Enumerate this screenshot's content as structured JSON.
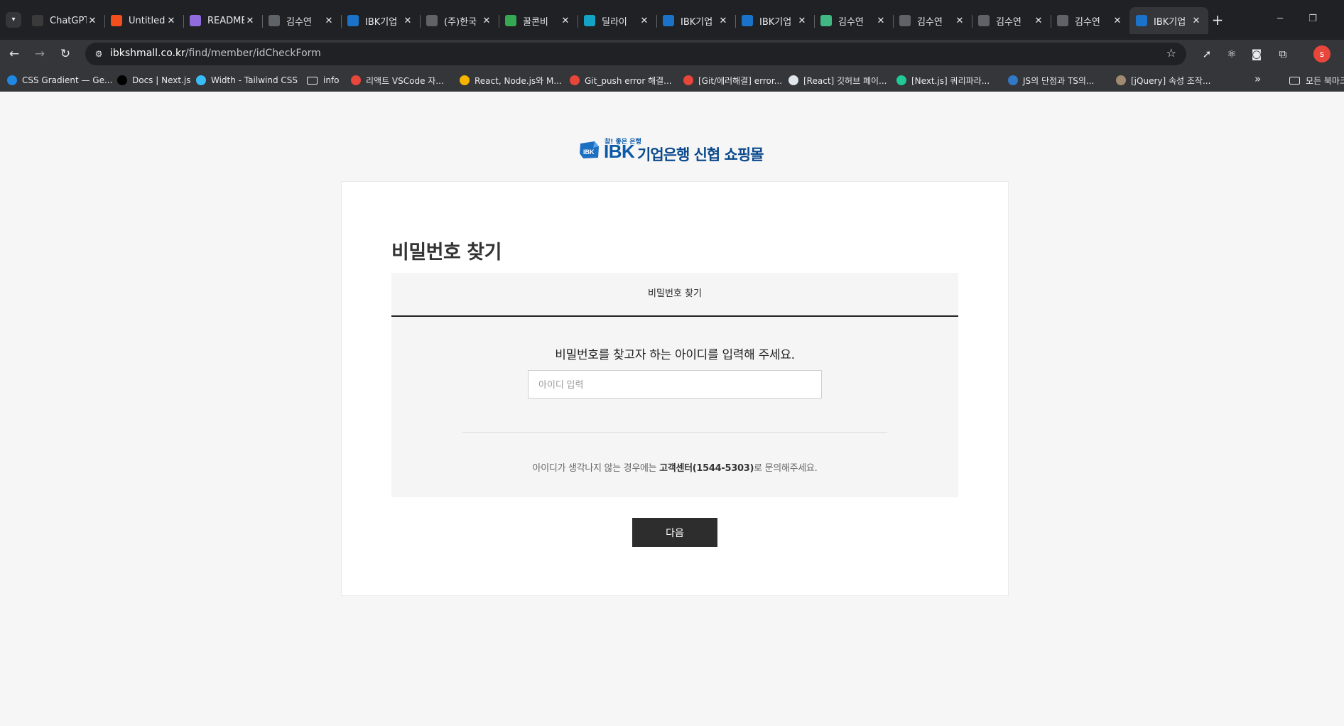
{
  "browser": {
    "tabs": [
      {
        "title": "ChatGPT",
        "icon": "chatgpt-icon",
        "color": "#3a3a3a"
      },
      {
        "title": "Untitled",
        "icon": "figma-icon",
        "color": "#f24e1e"
      },
      {
        "title": "README",
        "icon": "readme-icon",
        "color": "#8f6bdc"
      },
      {
        "title": "김수연",
        "icon": "globe-icon",
        "color": "#5f6368"
      },
      {
        "title": "IBK기업",
        "icon": "ibk-icon",
        "color": "#1a73c9"
      },
      {
        "title": "(주)한국",
        "icon": "globe-icon",
        "color": "#5f6368"
      },
      {
        "title": "꿀콘비",
        "icon": "play-icon",
        "color": "#34a853"
      },
      {
        "title": "딜라이",
        "icon": "d-icon",
        "color": "#13a3c4"
      },
      {
        "title": "IBK기업",
        "icon": "ibk-icon",
        "color": "#1a73c9"
      },
      {
        "title": "IBK기업",
        "icon": "ibk-icon",
        "color": "#1a73c9"
      },
      {
        "title": "김수연",
        "icon": "vue-icon",
        "color": "#41b883"
      },
      {
        "title": "김수연",
        "icon": "globe-icon",
        "color": "#5f6368"
      },
      {
        "title": "김수연",
        "icon": "globe-icon",
        "color": "#5f6368"
      },
      {
        "title": "김수연",
        "icon": "globe-icon",
        "color": "#5f6368"
      },
      {
        "title": "IBK기업",
        "icon": "ibk-icon",
        "color": "#1a73c9",
        "active": true
      }
    ],
    "url_host": "ibkshmall.co.kr",
    "url_path": "/find/member/idCheckForm",
    "profile_initial": "s",
    "bookmarks": [
      {
        "label": "CSS Gradient — Ge...",
        "icon": "css-gradient-icon",
        "color": "#1e88e5"
      },
      {
        "label": "Docs | Next.js",
        "icon": "nextjs-icon",
        "color": "#000000"
      },
      {
        "label": "Width - Tailwind CSS",
        "icon": "tailwind-icon",
        "color": "#38bdf8"
      },
      {
        "label": "info",
        "icon": "folder-icon",
        "color": ""
      },
      {
        "label": "리액트 VSCode 자...",
        "icon": "tistory-icon",
        "color": "#e8463a"
      },
      {
        "label": "React, Node.js와 M...",
        "icon": "pencil-icon",
        "color": "#f4b400"
      },
      {
        "label": "Git_push error 해결...",
        "icon": "tistory-icon",
        "color": "#e8463a"
      },
      {
        "label": "[Git/에러해결] error...",
        "icon": "tistory-icon",
        "color": "#e8463a"
      },
      {
        "label": "[React] 깃허브 페이...",
        "icon": "bookmark-page-icon",
        "color": "#dfe6ec"
      },
      {
        "label": "[Next.js] 쿼리파라...",
        "icon": "velog-icon",
        "color": "#20c997"
      },
      {
        "label": "JS의 단점과 TS의...",
        "icon": "ts-icon",
        "color": "#3178c6"
      },
      {
        "label": "[jQuery] 속성 조작...",
        "icon": "avatar-icon",
        "color": "#a08a70"
      }
    ],
    "bookmarks_folder": "모든 북마크"
  },
  "page": {
    "logo": {
      "slogan": "참! 좋은 은행",
      "brand": "IBK",
      "name": "기업은행 신협 쇼핑몰"
    },
    "title": "비밀번호 찾기",
    "tab_label": "비밀번호 찾기",
    "instruction": "비밀번호를 찾고자 하는 아이디를 입력해 주세요.",
    "id_input_placeholder": "아이디 입력",
    "id_input_value": "",
    "notice_pre": "아이디가 생각나지 않는 경우에는 ",
    "notice_cs": "고객센터(1544-5303)",
    "notice_post": "로 문의해주세요.",
    "next_button": "다음"
  }
}
